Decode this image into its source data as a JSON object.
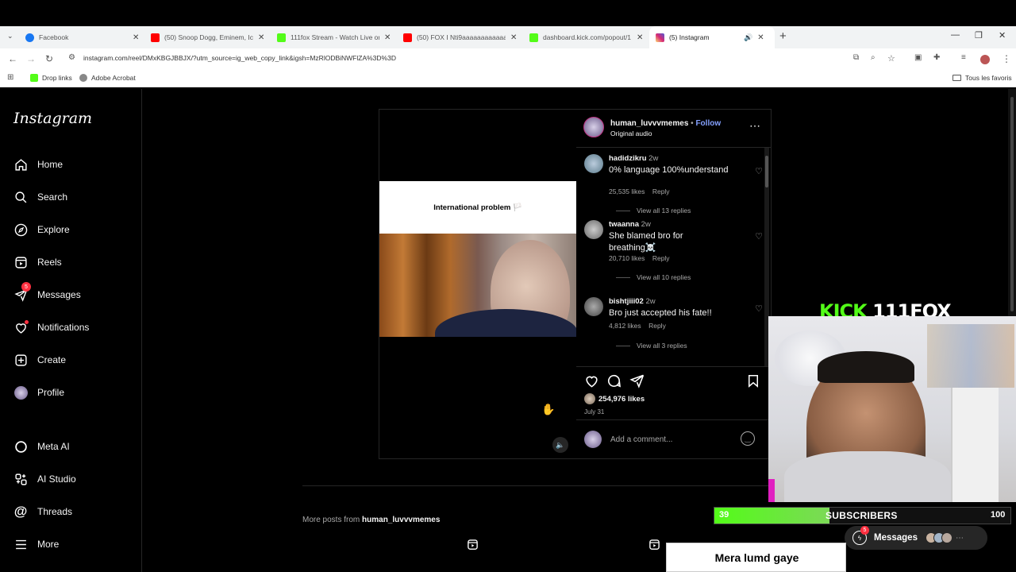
{
  "browser": {
    "tabs": [
      {
        "label": "Facebook",
        "color": "#1877f2",
        "active": false
      },
      {
        "label": "(50) Snoop Dogg, Eminem, Ice",
        "color": "#ff0000",
        "active": false
      },
      {
        "label": "111fox Stream - Watch Live on",
        "color": "#53fc18",
        "active": false
      },
      {
        "label": "(50) FOX I Nti9aaaaaaaaaaaaa",
        "color": "#ff0000",
        "active": false
      },
      {
        "label": "dashboard.kick.com/popout/1",
        "color": "#53fc18",
        "active": false
      },
      {
        "label": "(5) Instagram",
        "color": "#d6249f",
        "active": true
      }
    ],
    "url": "instagram.com/reel/DMxKBGJBBJX/?utm_source=ig_web_copy_link&igsh=MzRlODBiNWFlZA%3D%3D",
    "bookmarks": [
      {
        "label": "Drop links",
        "icon": "kick-icon"
      },
      {
        "label": "Adobe Acrobat",
        "icon": "acrobat-icon"
      }
    ],
    "favorites_label": "Tous les favoris"
  },
  "sidebar": {
    "logo": "Instagram",
    "items": [
      {
        "label": "Home",
        "icon": "home-icon"
      },
      {
        "label": "Search",
        "icon": "search-icon"
      },
      {
        "label": "Explore",
        "icon": "compass-icon"
      },
      {
        "label": "Reels",
        "icon": "reels-icon"
      },
      {
        "label": "Messages",
        "icon": "messenger-icon",
        "badge": "5"
      },
      {
        "label": "Notifications",
        "icon": "heart-icon",
        "dot": true
      },
      {
        "label": "Create",
        "icon": "plus-square-icon"
      },
      {
        "label": "Profile",
        "icon": "avatar-icon"
      },
      {
        "label": "Meta AI",
        "icon": "meta-ai-icon"
      },
      {
        "label": "AI Studio",
        "icon": "ai-studio-icon"
      },
      {
        "label": "Threads",
        "icon": "threads-icon"
      },
      {
        "label": "More",
        "icon": "menu-icon"
      }
    ]
  },
  "post": {
    "username": "human_luvvvmemes",
    "follow": "Follow",
    "audio": "Original audio",
    "video_caption": "International problem 🏳️",
    "comments": [
      {
        "user": "hadidzikru",
        "time": "2w",
        "text": "0% language 100%understand",
        "likes": "25,535 likes",
        "reply": "Reply",
        "replies": "View all 13 replies"
      },
      {
        "user": "twaanna",
        "time": "2w",
        "text": "She blamed bro for breathing☠️",
        "likes": "20,710 likes",
        "reply": "Reply",
        "replies": "View all 10 replies"
      },
      {
        "user": "bishtjiii02",
        "time": "2w",
        "text": "Bro just accepted his fate!!",
        "likes": "4,812 likes",
        "reply": "Reply",
        "replies": "View all 3 replies"
      }
    ],
    "likes": "254,976 likes",
    "date": "July 31",
    "add_comment": "Add a comment..."
  },
  "more_posts": {
    "prefix": "More posts from",
    "user": "human_luvvvmemes"
  },
  "stream": {
    "kick_word": "KICK",
    "channel": "111FOX",
    "sub_current": "39",
    "sub_label": "SUBSCRIBERS",
    "sub_goal": "100",
    "sub_progress": 0.39
  },
  "messages_pill": {
    "label": "Messages",
    "badge": "5"
  },
  "bottom_caption": "Mera lumd gaye"
}
